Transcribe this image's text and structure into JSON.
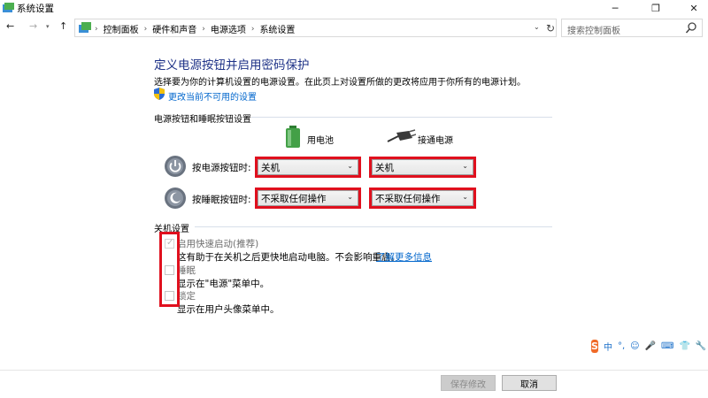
{
  "window": {
    "title": "系统设置",
    "minimize_glyph": "─",
    "maximize_glyph": "❐",
    "close_glyph": "✕"
  },
  "nav": {
    "back_glyph": "←",
    "forward_glyph": "→",
    "dropdown_glyph": "▾",
    "up_glyph": "↑"
  },
  "address": {
    "crumbs": [
      "控制面板",
      "硬件和声音",
      "电源选项",
      "系统设置"
    ],
    "separator": "›",
    "dropdown_glyph": "⌄",
    "refresh_glyph": "↻"
  },
  "search": {
    "placeholder": "搜索控制面板"
  },
  "page": {
    "title": "定义电源按钮并启用密码保护",
    "description": "选择要为你的计算机设置的电源设置。在此页上对设置所做的更改将应用于你所有的电源计划。",
    "change_link": "更改当前不可用的设置"
  },
  "buttons_section": {
    "label": "电源按钮和睡眠按钮设置",
    "col_battery": "用电池",
    "col_plugged": "接通电源",
    "rows": [
      {
        "label": "按电源按钮时:",
        "battery_value": "关机",
        "plugged_value": "关机"
      },
      {
        "label": "按睡眠按钮时:",
        "battery_value": "不采取任何操作",
        "plugged_value": "不采取任何操作"
      }
    ]
  },
  "shutdown_section": {
    "label": "关机设置",
    "options": [
      {
        "label": "启用快速启动(推荐)",
        "checked": true,
        "desc": "这有助于在关机之后更快地启动电脑。不会影响重启。",
        "link": "了解更多信息"
      },
      {
        "label": "睡眠",
        "checked": false,
        "desc": "显示在\"电源\"菜单中。"
      },
      {
        "label": "锁定",
        "checked": false,
        "desc": "显示在用户头像菜单中。"
      }
    ]
  },
  "ime": {
    "logo": "S",
    "items": [
      "中",
      "°,",
      "☺",
      "🎤",
      "⌨",
      "👕",
      "🔧"
    ]
  },
  "footer": {
    "save_label": "保存修改",
    "cancel_label": "取消"
  },
  "colors": {
    "title_blue": "#1e3287",
    "link_blue": "#0066cc",
    "highlight_red": "#e0101e"
  }
}
